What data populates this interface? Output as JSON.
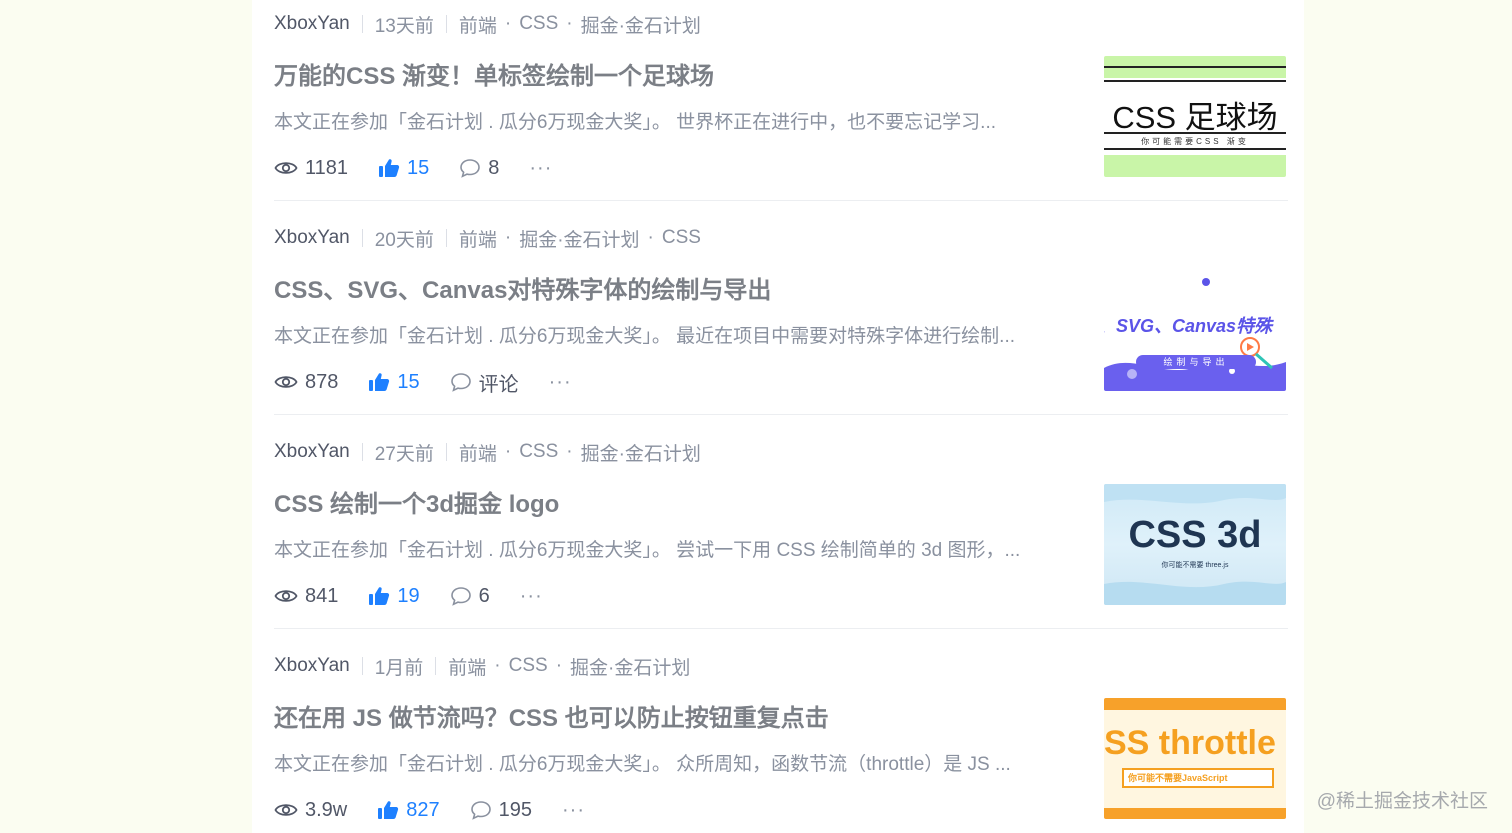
{
  "articles": [
    {
      "author": "XboxYan",
      "time": "13天前",
      "tags": [
        "前端",
        "CSS",
        "掘金·金石计划"
      ],
      "title": "万能的CSS 渐变！单标签绘制一个足球场",
      "abstract": "本文正在参加「金石计划 . 瓜分6万现金大奖」。 世界杯正在进行中，也不要忘记学习...",
      "views": "1181",
      "likes": "15",
      "comments": "8",
      "more": "···",
      "thumb": {
        "main": "CSS 足球场",
        "sub": "你可能需要CSS 渐变"
      }
    },
    {
      "author": "XboxYan",
      "time": "20天前",
      "tags": [
        "前端",
        "掘金·金石计划",
        "CSS"
      ],
      "title": "CSS、SVG、Canvas对特殊字体的绘制与导出",
      "abstract": "本文正在参加「金石计划 . 瓜分6万现金大奖」。 最近在项目中需要对特殊字体进行绘制...",
      "views": "878",
      "likes": "15",
      "comments": "评论",
      "more": "···",
      "thumb": {
        "main": "、SVG、Canvas特殊",
        "sub": "绘制与导出"
      }
    },
    {
      "author": "XboxYan",
      "time": "27天前",
      "tags": [
        "前端",
        "CSS",
        "掘金·金石计划"
      ],
      "title": "CSS 绘制一个3d掘金 logo",
      "abstract": "本文正在参加「金石计划 . 瓜分6万现金大奖」。 尝试一下用 CSS 绘制简单的 3d 图形，...",
      "views": "841",
      "likes": "19",
      "comments": "6",
      "more": "···",
      "thumb": {
        "main": "CSS 3d",
        "sub": "你可能不需要 three.js"
      }
    },
    {
      "author": "XboxYan",
      "time": "1月前",
      "tags": [
        "前端",
        "CSS",
        "掘金·金石计划"
      ],
      "title": "还在用 JS 做节流吗？CSS 也可以防止按钮重复点击",
      "abstract": "本文正在参加「金石计划 . 瓜分6万现金大奖」。 众所周知，函数节流（throttle）是 JS ...",
      "views": "3.9w",
      "likes": "827",
      "comments": "195",
      "more": "···",
      "thumb": {
        "main": "SS throttle",
        "sub": "你可能不需要JavaScript"
      }
    }
  ],
  "watermark": "@稀土掘金技术社区",
  "colors": {
    "accent": "#1e80ff",
    "page_bg": "#fbfdf1"
  }
}
